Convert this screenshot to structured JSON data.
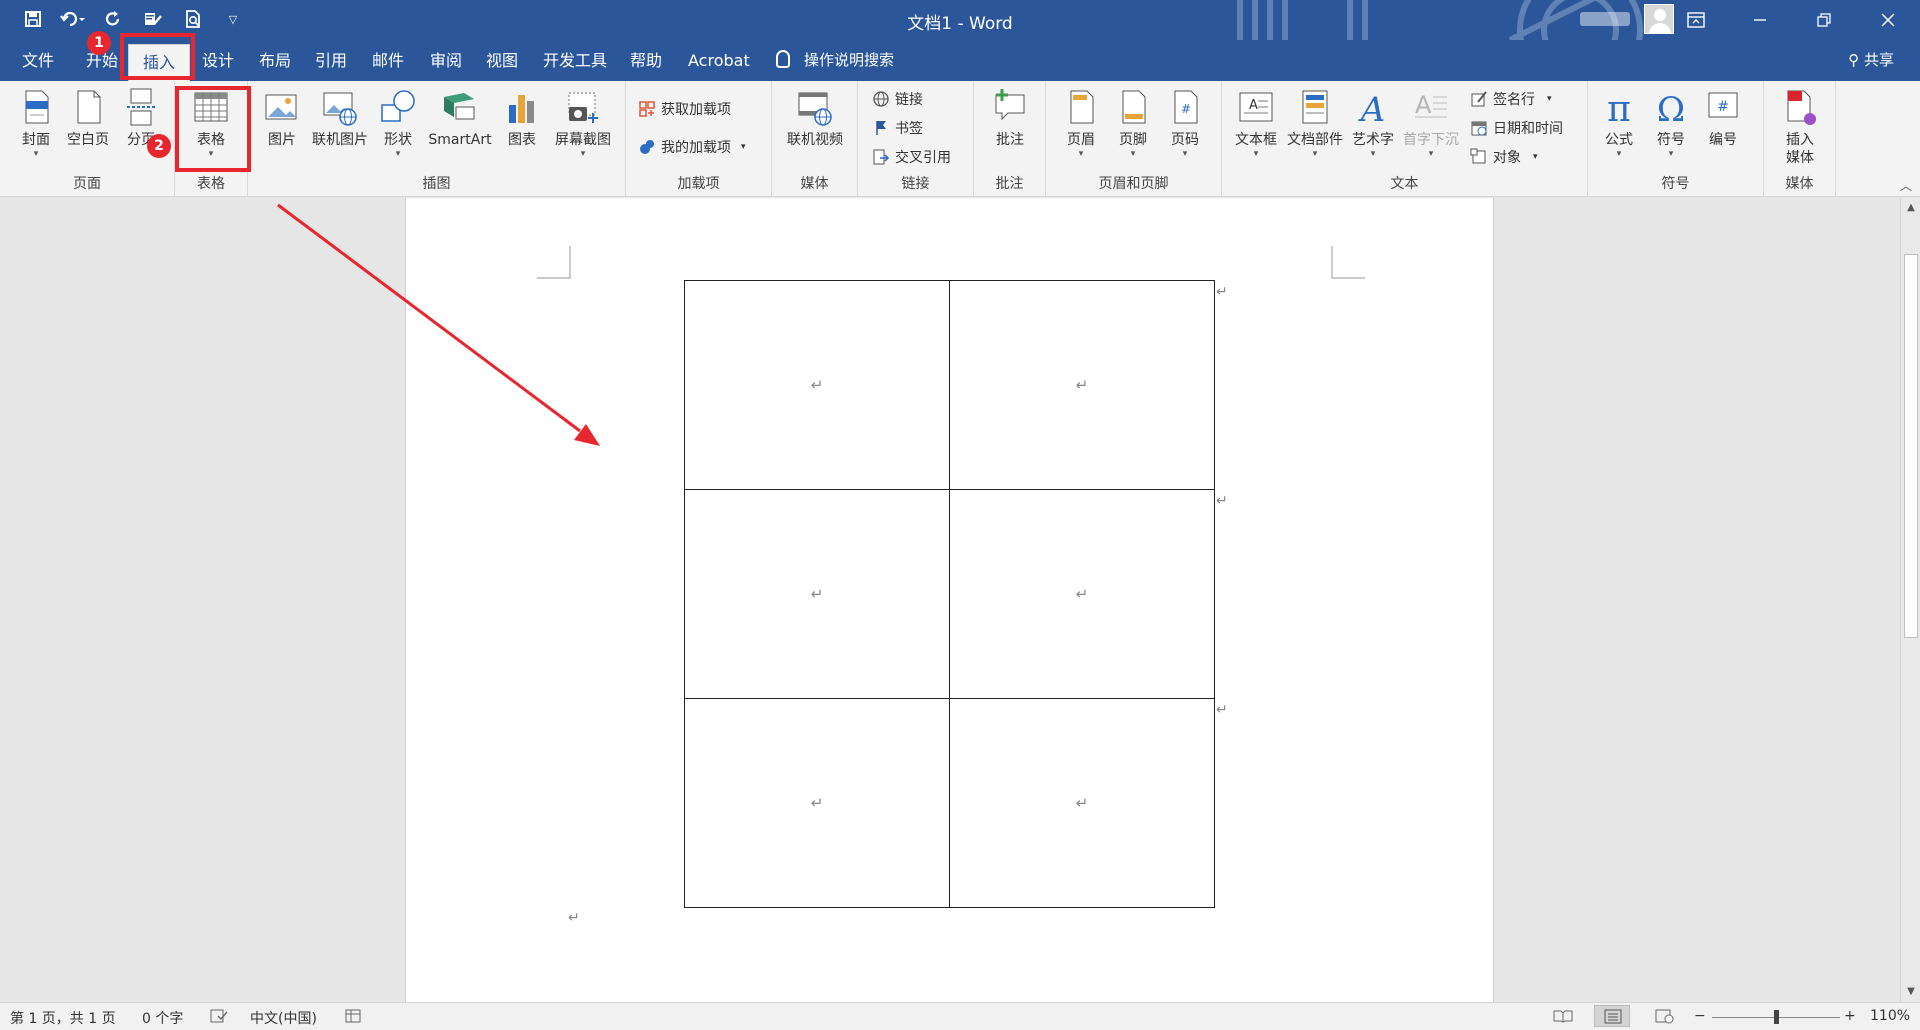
{
  "window": {
    "title": "文档1 - Word"
  },
  "qat": {
    "icons": [
      "save-icon",
      "undo-icon",
      "redo-icon",
      "check-icon",
      "print-preview-icon",
      "customize-qat-icon"
    ]
  },
  "tabs": [
    "文件",
    "开始",
    "插入",
    "设计",
    "布局",
    "引用",
    "邮件",
    "审阅",
    "视图",
    "开发工具",
    "帮助",
    "Acrobat"
  ],
  "active_tab": "插入",
  "tell_me": "操作说明搜索",
  "share": "共享",
  "ribbon": {
    "groups": {
      "pages": "页面",
      "tables": "表格",
      "illustrations": "插图",
      "addins": "加载项",
      "media": "媒体",
      "links": "链接",
      "comments": "批注",
      "header_footer": "页眉和页脚",
      "text": "文本",
      "symbols": "符号",
      "media2": "媒体"
    },
    "cover_page": "封面",
    "blank_page": "空白页",
    "page_break": "分页",
    "table": "表格",
    "pictures": "图片",
    "online_pictures": "联机图片",
    "shapes": "形状",
    "smartart": "SmartArt",
    "chart": "图表",
    "screenshot": "屏幕截图",
    "get_addins": "获取加载项",
    "my_addins": "我的加载项",
    "online_video": "联机视频",
    "link": "链接",
    "bookmark": "书签",
    "cross_ref": "交叉引用",
    "comment": "批注",
    "header": "页眉",
    "footer": "页脚",
    "page_number": "页码",
    "text_box": "文本框",
    "quick_parts": "文档部件",
    "wordart": "艺术字",
    "drop_cap": "首字下沉",
    "signature_line": "签名行",
    "date_time": "日期和时间",
    "object": "对象",
    "equation": "公式",
    "symbol": "符号",
    "number": "编号",
    "insert_media": "插入媒体"
  },
  "annotations": {
    "badge1": "1",
    "badge2": "2"
  },
  "document": {
    "para_mark": "↵",
    "table_rows": [
      [
        "↵",
        "↵"
      ],
      [
        "↵",
        "↵"
      ],
      [
        "↵",
        "↵"
      ]
    ]
  },
  "status": {
    "page": "第 1 页，共 1 页",
    "words": "0 个字",
    "language": "中文(中国)",
    "zoom_minus": "−",
    "zoom_plus": "+",
    "zoom": "110%"
  }
}
